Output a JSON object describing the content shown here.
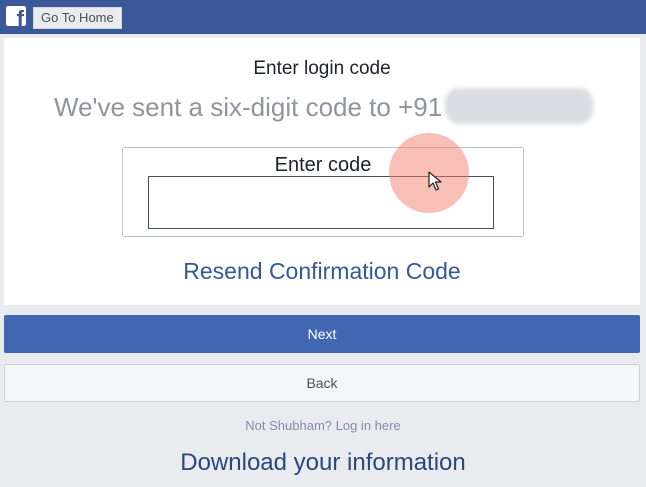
{
  "header": {
    "logo_letter": "f",
    "home_label": "Go To Home"
  },
  "card": {
    "title": "Enter login code",
    "subtitle": "We've sent a six-digit code to +91",
    "code_label": "Enter code",
    "code_value": "",
    "resend_label": "Resend Confirmation Code"
  },
  "actions": {
    "next_label": "Next",
    "back_label": "Back"
  },
  "footer": {
    "not_you_label": "Not Shubham? Log in here",
    "download_label": "Download your information"
  },
  "colors": {
    "brand": "#3b5998",
    "button_primary": "#4267b2",
    "link": "#365899"
  }
}
